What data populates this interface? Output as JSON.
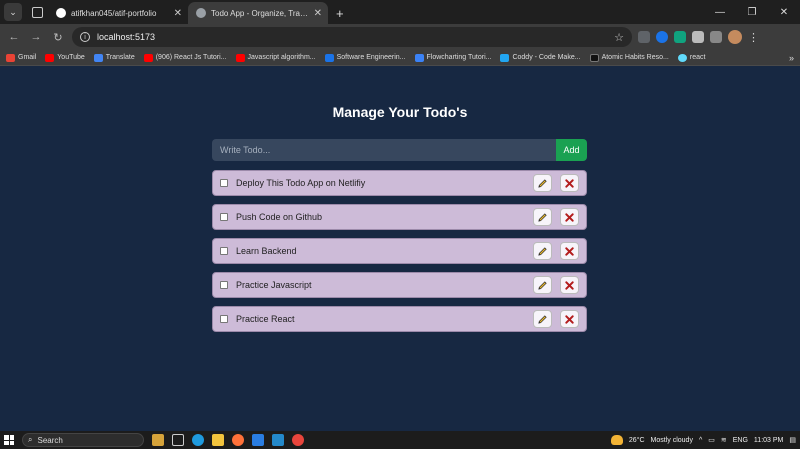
{
  "browser": {
    "tabs": [
      {
        "title": "atifkhan045/atif-portfolio",
        "active": false,
        "favicon_color": "#ffffff"
      },
      {
        "title": "Todo App - Organize, Track, and",
        "active": true,
        "favicon_color": "#9aa0a6"
      }
    ],
    "new_tab_icon": "plus-icon",
    "url": "localhost:5173",
    "bookmarks": [
      {
        "label": "Gmail",
        "color": "#ea4335"
      },
      {
        "label": "YouTube",
        "color": "#ff0000"
      },
      {
        "label": "Translate",
        "color": "#4285f4"
      },
      {
        "label": "(906) React Js Tutori...",
        "color": "#ff0000"
      },
      {
        "label": "Javascript algorithm...",
        "color": "#ff0000"
      },
      {
        "label": "Software Engineerin...",
        "color": "#1a73e8"
      },
      {
        "label": "Flowcharting Tutori...",
        "color": "#3b82f6"
      },
      {
        "label": "Coddy - Code Make...",
        "color": "#22a6f2"
      },
      {
        "label": "Atomic Habits Reso...",
        "color": "#111111"
      },
      {
        "label": "react",
        "color": "#61dafb"
      }
    ]
  },
  "app": {
    "title": "Manage Your Todo's",
    "input_placeholder": "Write Todo...",
    "add_label": "Add",
    "todos": [
      {
        "text": "Deploy This Todo App on Netlifiy",
        "completed": false
      },
      {
        "text": "Push Code on Github",
        "completed": false
      },
      {
        "text": "Learn Backend",
        "completed": false
      },
      {
        "text": "Practice Javascript",
        "completed": false
      },
      {
        "text": "Practice React",
        "completed": false
      }
    ],
    "colors": {
      "background": "#172842",
      "item_background": "#cdbbd8",
      "add_button": "#1aa152",
      "input_background": "#37475e"
    }
  },
  "taskbar": {
    "search_label": "Search",
    "weather": "26°C",
    "weather_desc": "Mostly cloudy",
    "lang": "ENG",
    "time": "11:03 PM"
  }
}
